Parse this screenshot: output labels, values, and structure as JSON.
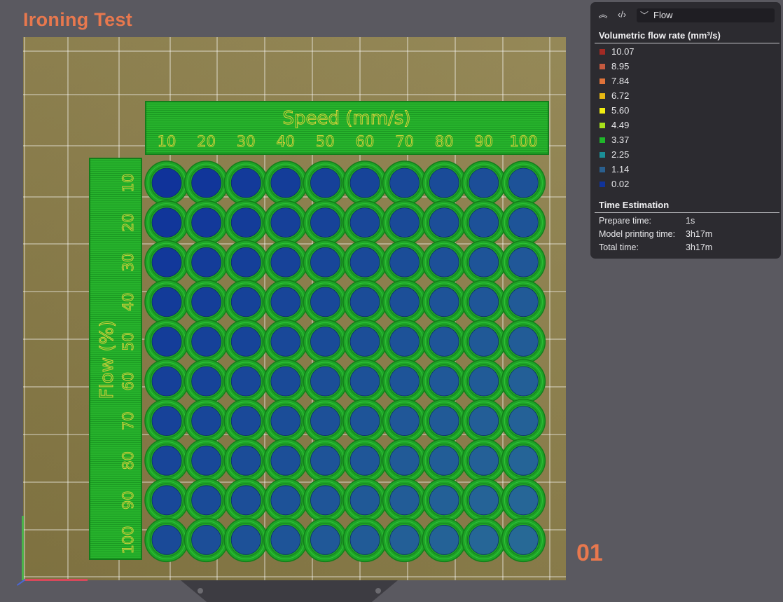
{
  "plate": {
    "title": "Ironing Test",
    "number": "01"
  },
  "model": {
    "speed_label": "Speed (mm/s)",
    "speed_values": [
      "10",
      "20",
      "30",
      "40",
      "50",
      "60",
      "70",
      "80",
      "90",
      "100"
    ],
    "flow_label": "Flow (%)",
    "flow_values": [
      "10",
      "20",
      "30",
      "40",
      "50",
      "60",
      "70",
      "80",
      "90",
      "100"
    ]
  },
  "legend": {
    "view_select": "Flow",
    "section_title": "Volumetric flow rate (mm³/s)",
    "items": [
      {
        "label": "10.07",
        "color": "#a32a24"
      },
      {
        "label": "8.95",
        "color": "#c55a3f"
      },
      {
        "label": "7.84",
        "color": "#e0733a"
      },
      {
        "label": "6.72",
        "color": "#e8b812"
      },
      {
        "label": "5.60",
        "color": "#f2ee11"
      },
      {
        "label": "4.49",
        "color": "#a8e21b"
      },
      {
        "label": "3.37",
        "color": "#1fb62a"
      },
      {
        "label": "2.25",
        "color": "#1b8e96"
      },
      {
        "label": "1.14",
        "color": "#2a5f8e"
      },
      {
        "label": "0.02",
        "color": "#10339a"
      }
    ],
    "time_title": "Time Estimation",
    "time": [
      {
        "label": "Prepare time:",
        "value": "1s"
      },
      {
        "label": "Model printing time:",
        "value": "3h17m"
      },
      {
        "label": "Total time:",
        "value": "3h17m"
      }
    ]
  },
  "colors": {
    "accent": "#e8784e",
    "bed": "#8a7c46",
    "print_green": "#1fb62a",
    "fill_blue": "#10339a",
    "fill_teal": "#2a6f96",
    "label_yellow": "#d8d23a"
  },
  "icons": [
    "collapse-icon",
    "code-view-icon",
    "chevron-down-icon"
  ]
}
